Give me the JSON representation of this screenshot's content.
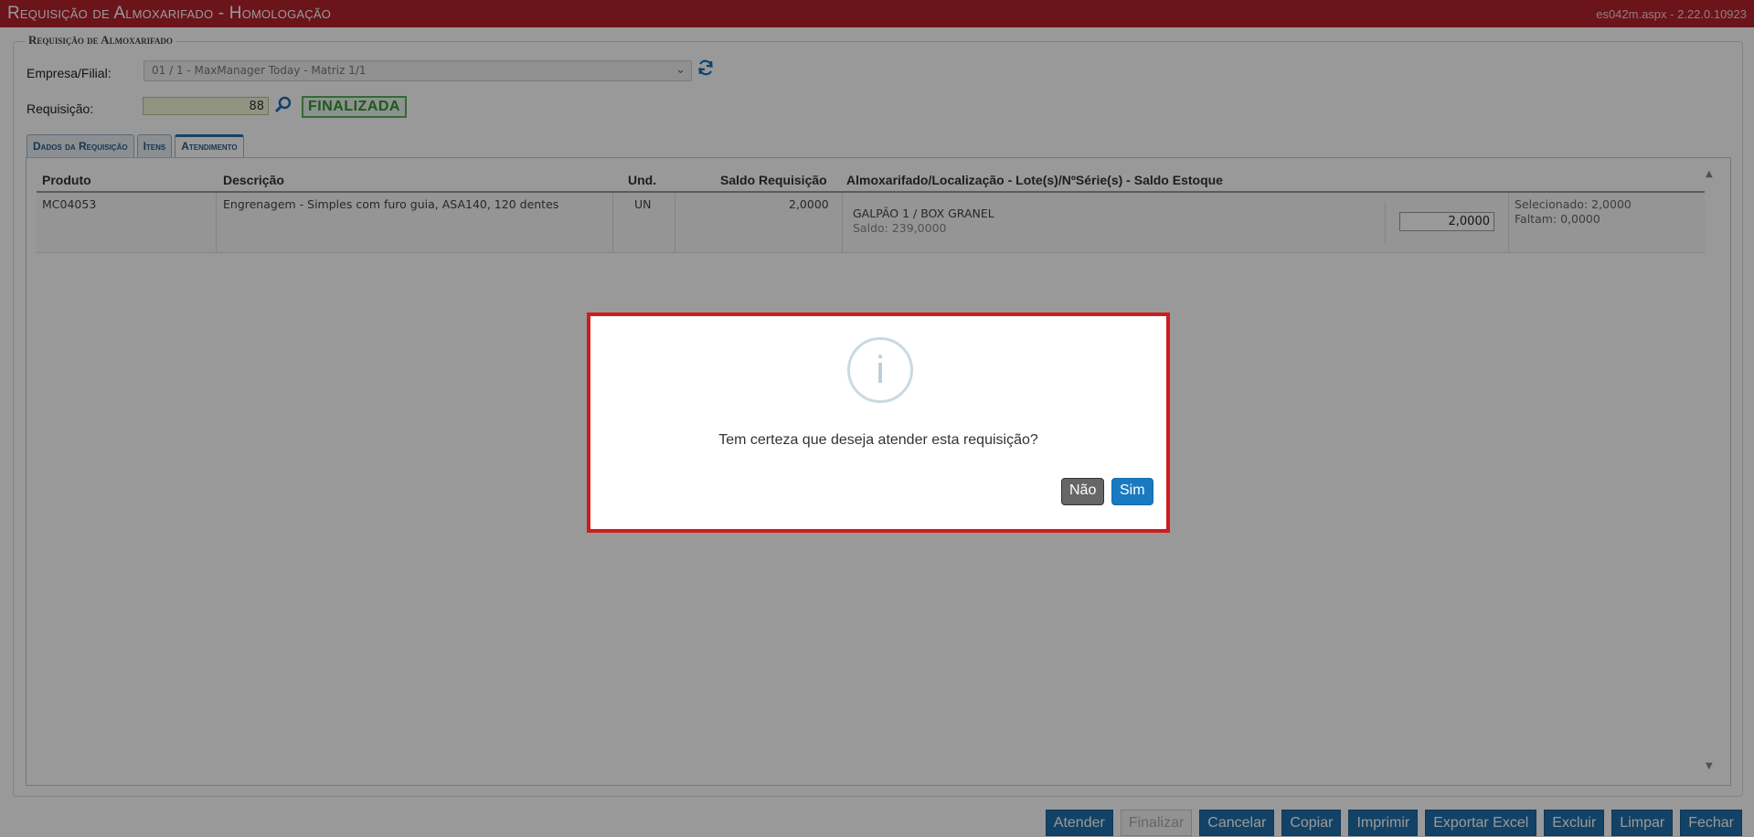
{
  "window": {
    "title": "Requisição de Almoxarifado  - Homologação",
    "version": "es042m.aspx - 2.22.0.10923"
  },
  "form": {
    "legend": "Requisição de Almoxarifado",
    "empresa_label": "Empresa/Filial:",
    "empresa_value": "01 / 1 - MaxManager Today - Matriz 1/1",
    "requisicao_label": "Requisição:",
    "requisicao_value": "88",
    "status": "FINALIZADA"
  },
  "tabs": [
    {
      "label": "Dados da Requisição",
      "active": false
    },
    {
      "label": "Itens",
      "active": false
    },
    {
      "label": "Atendimento",
      "active": true
    }
  ],
  "grid": {
    "headers": {
      "produto": "Produto",
      "descricao": "Descrição",
      "und": "Und.",
      "saldo": "Saldo Requisição",
      "almox": "Almoxarifado/Localização - Lote(s)/NºSérie(s) - Saldo Estoque"
    },
    "rows": [
      {
        "produto": "MC04053",
        "descricao": "Engrenagem - Simples com furo guia, ASA140, 120 dentes",
        "und": "UN",
        "saldo": "2,0000",
        "local": "GALPÃO 1 / BOX GRANEL",
        "local_saldo": "Saldo: 239,0000",
        "quantidade": "2,0000",
        "selecionado": "Selecionado: 2,0000",
        "faltam": "Faltam: 0,0000"
      }
    ]
  },
  "buttons": {
    "atender": "Atender",
    "finalizar": "Finalizar",
    "cancelar": "Cancelar",
    "copiar": "Copiar",
    "imprimir": "Imprimir",
    "exportar": "Exportar Excel",
    "excluir": "Excluir",
    "limpar": "Limpar",
    "fechar": "Fechar"
  },
  "dialog": {
    "icon": "info-icon",
    "icon_glyph": "i",
    "message": "Tem certeza que deseja atender esta requisição?",
    "no_label": "Não",
    "yes_label": "Sim"
  },
  "colors": {
    "titlebar": "#b3222a",
    "accent": "#1f6ea9",
    "status_green": "#35923a",
    "dialog_border": "#d01c1c"
  }
}
